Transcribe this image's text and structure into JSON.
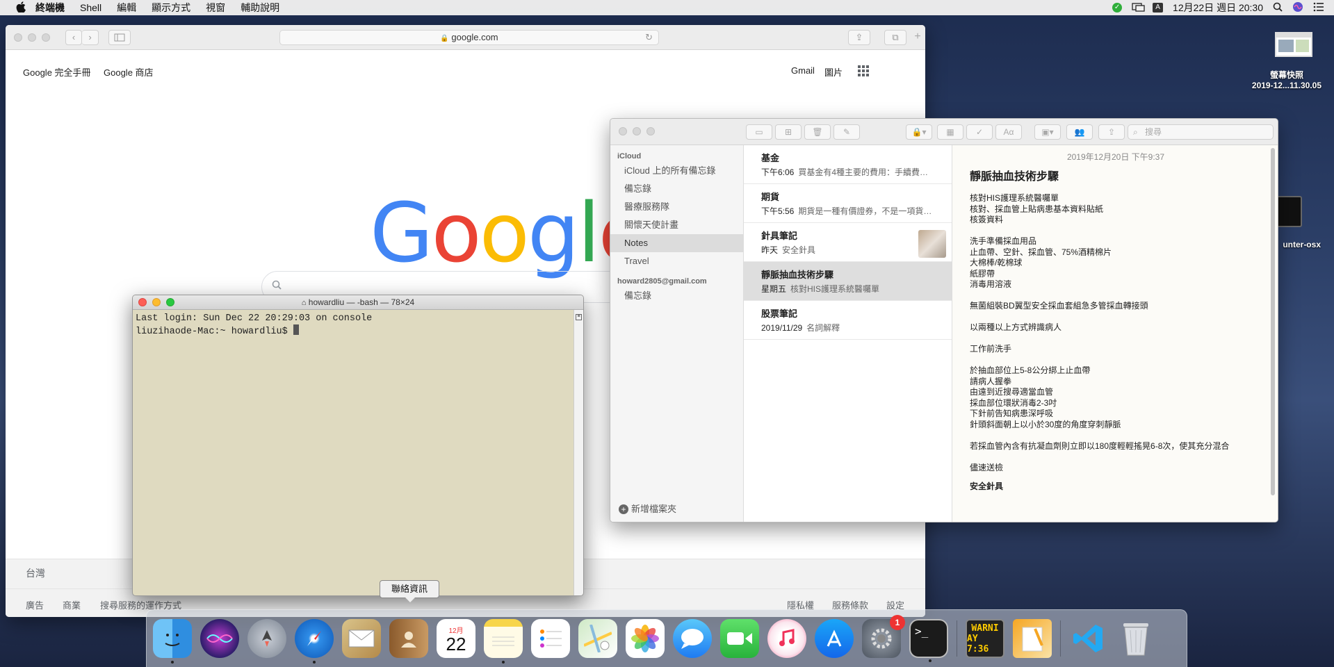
{
  "menubar": {
    "apple": "",
    "items": [
      "終端機",
      "Shell",
      "編輯",
      "顯示方式",
      "視窗",
      "輔助說明"
    ],
    "clock": "12月22日 週日 20:30",
    "input_method": "A"
  },
  "desktop": {
    "screenshot_label_line1": "螢幕快照",
    "screenshot_label_line2": "2019-12...11.30.05",
    "terminal_file_label": "unter-osx"
  },
  "safari": {
    "url": "google.com",
    "top_left_links": [
      "Google 完全手冊",
      "Google 商店"
    ],
    "top_right_links": [
      "Gmail",
      "圖片"
    ],
    "logo_letters": [
      {
        "ch": "G",
        "color": "#4285F4"
      },
      {
        "ch": "o",
        "color": "#EA4335"
      },
      {
        "ch": "o",
        "color": "#FBBC05"
      },
      {
        "ch": "g",
        "color": "#4285F4"
      },
      {
        "ch": "l",
        "color": "#34A853"
      },
      {
        "ch": "e",
        "color": "#EA4335"
      }
    ],
    "footer": {
      "country": "台灣",
      "left_links": [
        "廣告",
        "商業",
        "搜尋服務的運作方式"
      ],
      "right_links": [
        "隱私權",
        "服務條款",
        "設定"
      ]
    }
  },
  "terminal": {
    "title": "howardliu — -bash — 78×24",
    "line1": "Last login: Sun Dec 22 20:29:03 on console",
    "prompt": "liuzihaode-Mac:~ howardliu$ "
  },
  "tooltip": "聯絡資訊",
  "notes": {
    "search_placeholder": "搜尋",
    "sections": [
      {
        "header": "iCloud",
        "items": [
          "iCloud 上的所有備忘錄",
          "備忘錄",
          "醫療服務隊",
          "關懷天使計畫",
          "Notes",
          "Travel"
        ],
        "selected": "Notes"
      },
      {
        "header": "howard2805@gmail.com",
        "items": [
          "備忘錄"
        ]
      }
    ],
    "new_folder": "新增檔案夾",
    "list": [
      {
        "title": "基金",
        "time": "下午6:06",
        "preview": "買基金有4種主要的費用：手續費…"
      },
      {
        "title": "期貨",
        "time": "下午5:56",
        "preview": "期貨是一種有價證券，不是一項貨…"
      },
      {
        "title": "針具筆記",
        "time": "昨天",
        "preview": "安全針具"
      },
      {
        "title": "靜脈抽血技術步驟",
        "time": "星期五",
        "preview": "核對HIS護理系統醫囑單"
      },
      {
        "title": "股票筆記",
        "time": "2019/11/29",
        "preview": "名詞解釋"
      }
    ],
    "note": {
      "date": "2019年12月20日 下午9:37",
      "title": "靜脈抽血技術步驟",
      "body": "核對HIS護理系統醫囑單\n核對、採血管上貼病患基本資料貼紙\n核簽資料\n\n洗手準備採血用品\n止血帶、空針、採血管、75%酒精棉片\n大棉棒/乾棉球\n紙膠帶\n消毒用溶液\n\n無菌組裝BD翼型安全採血套組急多管採血轉接頭\n\n以兩種以上方式辨識病人\n\n工作前洗手\n\n於抽血部位上5-8公分綁上止血帶\n請病人握拳\n由遠到近搜尋適當血管\n採血部位環狀消毒2-3吋\n下針前告知病患深呼吸\n針頭斜面朝上以小於30度的角度穿刺靜脈\n\n若採血管內含有抗凝血劑則立即以180度輕輕搖晃6-8次，使其充分混合\n\n儘速送檢\n\n",
      "footer_bold": "安全針具"
    }
  },
  "dock": {
    "calendar_month": "12月",
    "calendar_day": "22",
    "badge_count": "1",
    "console_text_line1": "WARNI",
    "console_text_line2": "AY 7:36"
  }
}
